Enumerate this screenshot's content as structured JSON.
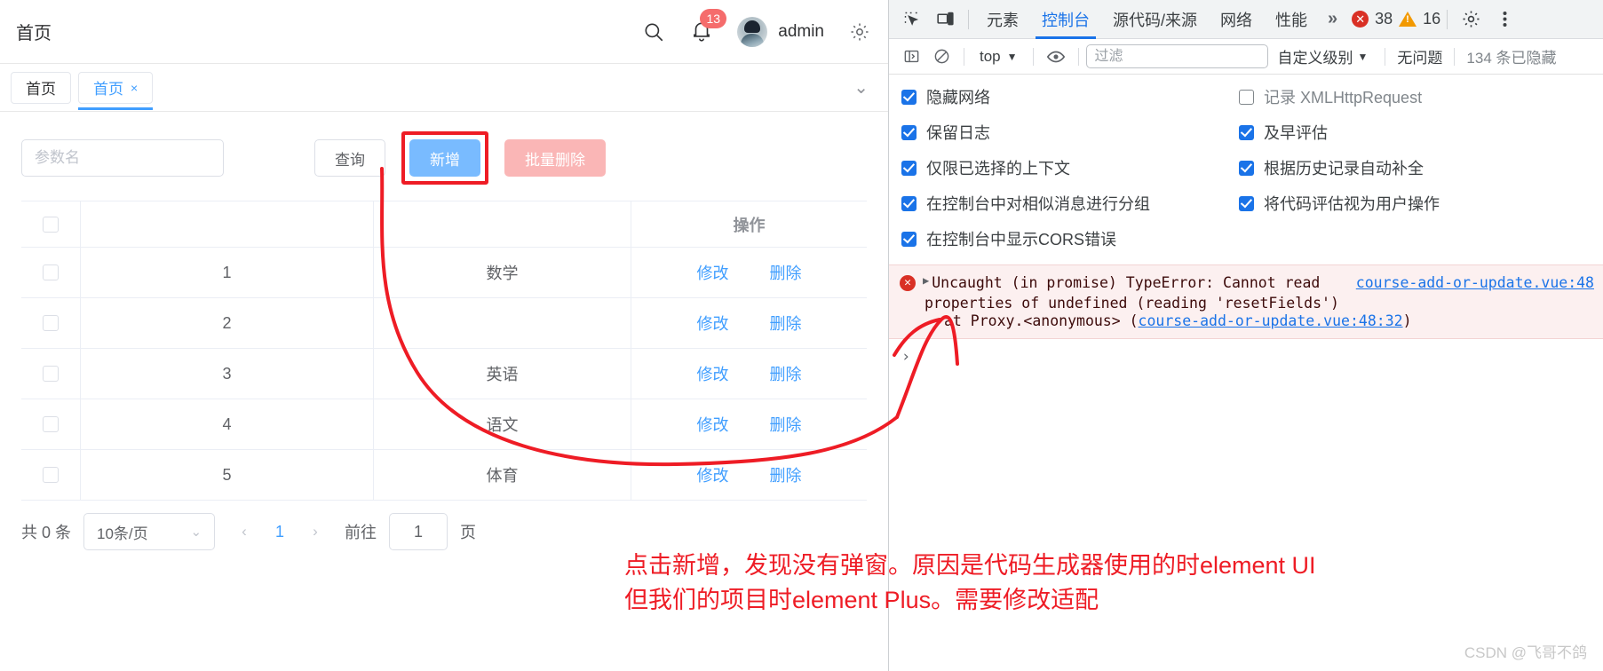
{
  "app": {
    "header": {
      "breadcrumb": "首页",
      "search_icon": "search-icon",
      "bell_icon": "bell-icon",
      "badge_count": "13",
      "username": "admin",
      "gear_icon": "gear-icon"
    },
    "tabs": {
      "items": [
        {
          "label": "首页",
          "active": false,
          "closable": false
        },
        {
          "label": "首页",
          "active": true,
          "closable": true,
          "close_glyph": "×"
        }
      ],
      "chevron_glyph": "⌄"
    },
    "toolbar": {
      "search_placeholder": "参数名",
      "search_value": "",
      "query_label": "查询",
      "add_label": "新增",
      "batch_delete_label": "批量删除"
    },
    "table": {
      "headers": [
        "",
        "",
        "",
        "操作"
      ],
      "op_header": "操作",
      "rows": [
        {
          "id": "1",
          "name": "数学",
          "edit": "修改",
          "delete": "删除"
        },
        {
          "id": "2",
          "name": "",
          "edit": "修改",
          "delete": "删除"
        },
        {
          "id": "3",
          "name": "英语",
          "edit": "修改",
          "delete": "删除"
        },
        {
          "id": "4",
          "name": "语文",
          "edit": "修改",
          "delete": "删除"
        },
        {
          "id": "5",
          "name": "体育",
          "edit": "修改",
          "delete": "删除"
        }
      ]
    },
    "pagination": {
      "total_text": "共 0 条",
      "page_size": "10条/页",
      "prev_glyph": "‹",
      "next_glyph": "›",
      "current_page": "1",
      "jump_label": "前往",
      "jump_value": "1",
      "jump_unit": "页"
    }
  },
  "devtools": {
    "tabbar": {
      "inspect_icon": "inspect-element-icon",
      "device_icon": "device-toolbar-icon",
      "tabs": [
        {
          "label": "元素",
          "active": false
        },
        {
          "label": "控制台",
          "active": true
        },
        {
          "label": "源代码/来源",
          "active": false
        },
        {
          "label": "网络",
          "active": false
        },
        {
          "label": "性能",
          "active": false
        }
      ],
      "more_glyph": "»",
      "error_count": "38",
      "warning_count": "16",
      "settings_icon": "gear-icon",
      "menu_icon": "kebab-menu-icon"
    },
    "toolbar": {
      "sidebar_icon": "console-sidebar-icon",
      "clear_icon": "clear-console-icon",
      "context_value": "top",
      "context_caret": "▼",
      "eye_icon": "live-expression-icon",
      "filter_placeholder": "过滤",
      "filter_value": "",
      "level_label": "自定义级别",
      "level_caret": "▼",
      "no_issues_label": "无问题",
      "hidden_label": "134 条已隐藏"
    },
    "settings": {
      "left_options": [
        {
          "label": "隐藏网络",
          "checked": true
        },
        {
          "label": "保留日志",
          "checked": true
        },
        {
          "label": "仅限已选择的上下文",
          "checked": true
        },
        {
          "label": "在控制台中对相似消息进行分组",
          "checked": true
        },
        {
          "label": "在控制台中显示CORS错误",
          "checked": true
        }
      ],
      "right_options": [
        {
          "label": "记录 XMLHttpRequest",
          "checked": false
        },
        {
          "label": "及早评估",
          "checked": true
        },
        {
          "label": "根据历史记录自动补全",
          "checked": true
        },
        {
          "label": "将代码评估视为用户操作",
          "checked": true
        }
      ]
    },
    "console": {
      "error_badge": "✕",
      "expand_glyph": "▶",
      "error_line1": "Uncaught (in promise) TypeError: Cannot read",
      "error_line2": "properties of undefined (reading 'resetFields')",
      "error_source": "course-add-or-update.vue:48",
      "stack_prefix": "at Proxy.<anonymous> (",
      "stack_link": "course-add-or-update.vue:48:32",
      "stack_suffix": ")",
      "prompt_glyph": "›"
    }
  },
  "annotations": {
    "note_line1": "点击新增，发现没有弹窗。原因是代码生成器使用的时element UI",
    "note_line2": "但我们的项目时element Plus。需要修改适配",
    "watermark": "CSDN @飞哥不鸽",
    "highlight_color": "#ee1c25"
  }
}
